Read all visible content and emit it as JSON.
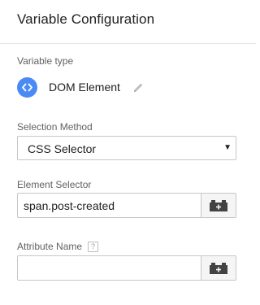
{
  "header": {
    "title": "Variable Configuration"
  },
  "variable_type": {
    "label": "Variable type",
    "name": "DOM Element",
    "icon": "code-brackets-icon",
    "icon_color": "#4a8af4",
    "edit_icon": "pencil-icon"
  },
  "selection_method": {
    "label": "Selection Method",
    "value": "CSS Selector",
    "arrow": "▼"
  },
  "element_selector": {
    "label": "Element Selector",
    "value": "span.post-created",
    "variable_button_icon": "lego-brick-plus-icon"
  },
  "attribute_name": {
    "label": "Attribute Name",
    "help": "?",
    "value": "",
    "variable_button_icon": "lego-brick-plus-icon"
  }
}
